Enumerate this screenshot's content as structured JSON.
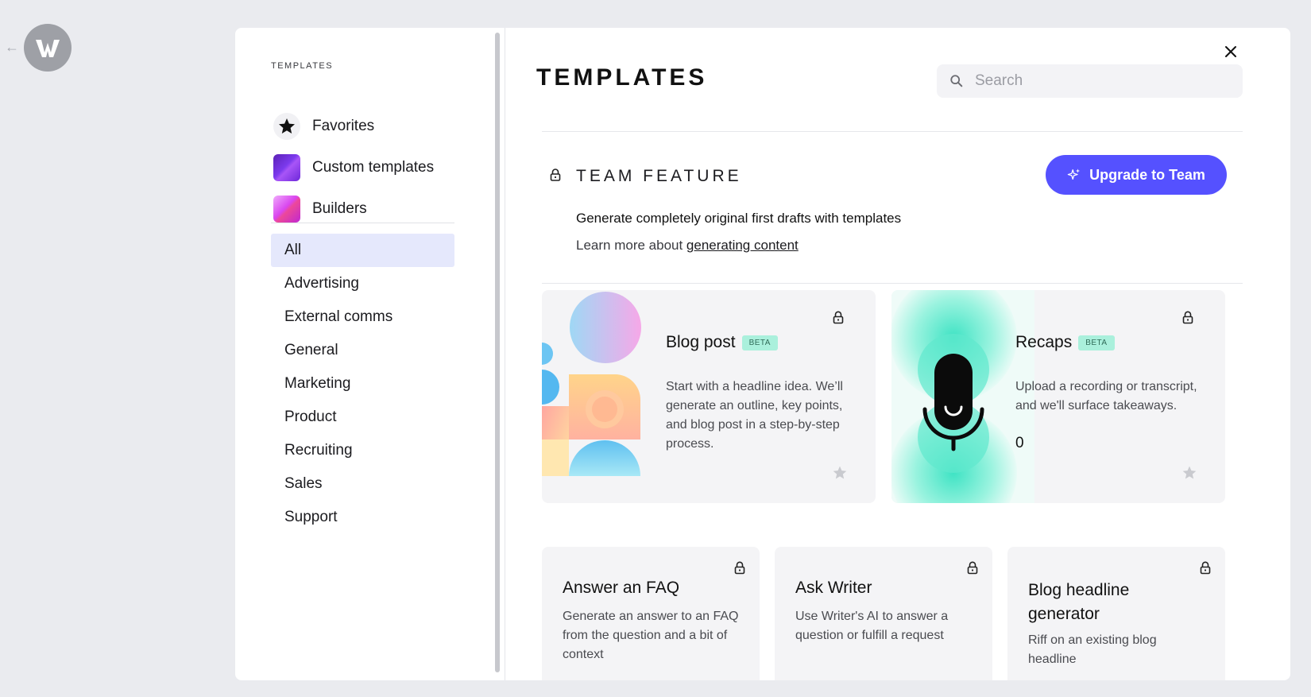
{
  "app": {
    "logo_letter": "W"
  },
  "sidebar": {
    "heading": "TEMPLATES",
    "top_items": [
      {
        "label": "Favorites",
        "icon": "star-icon"
      },
      {
        "label": "Custom templates",
        "icon": "custom-templates-icon"
      },
      {
        "label": "Builders",
        "icon": "builders-icon"
      }
    ],
    "categories": [
      {
        "label": "All",
        "active": true
      },
      {
        "label": "Advertising"
      },
      {
        "label": "External comms"
      },
      {
        "label": "General"
      },
      {
        "label": "Marketing"
      },
      {
        "label": "Product"
      },
      {
        "label": "Recruiting"
      },
      {
        "label": "Sales"
      },
      {
        "label": "Support"
      }
    ]
  },
  "main": {
    "title": "TEMPLATES",
    "search": {
      "placeholder": "Search",
      "value": ""
    },
    "team_feature": {
      "title": "TEAM FEATURE",
      "upgrade_label": "Upgrade to Team",
      "description": "Generate completely original first drafts with templates",
      "learn_prefix": "Learn more about ",
      "learn_link": "generating content"
    },
    "featured_cards": [
      {
        "title": "Blog post",
        "badge": "BETA",
        "description": "Start with a headline idea. We’ll generate an outline, key points, and blog post in a step-by-step process."
      },
      {
        "title": "Recaps",
        "badge": "BETA",
        "description": "Upload a recording or transcript, and we'll surface takeaways.",
        "count": "0"
      }
    ],
    "cards": [
      {
        "title": "Answer an FAQ",
        "description": "Generate an answer to an FAQ from the question and a bit of context"
      },
      {
        "title": "Ask Writer",
        "description": "Use Writer's AI to answer a question or fulfill a request"
      },
      {
        "title": "Blog headline generator",
        "description": "Riff on an existing blog headline"
      }
    ]
  },
  "colors": {
    "accent": "#5551ff",
    "active_category_bg": "#e5e8fc",
    "beta_badge_bg": "#aaf0dc",
    "page_bg": "#eaebef"
  }
}
